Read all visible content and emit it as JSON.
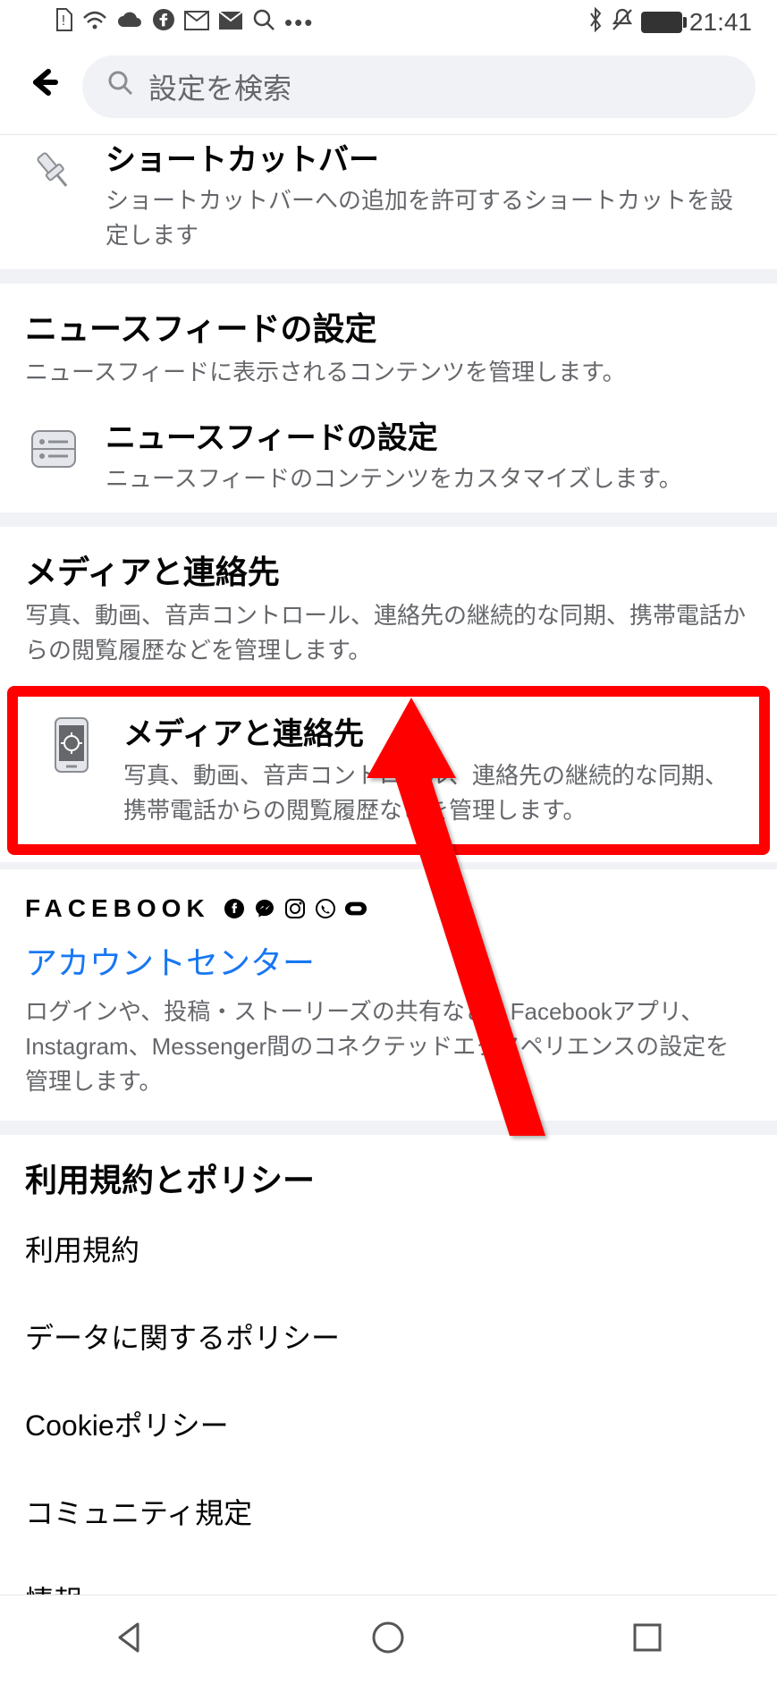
{
  "status": {
    "time": "21:41"
  },
  "search": {
    "placeholder": "設定を検索"
  },
  "shortcut": {
    "title": "ショートカットバー",
    "sub": "ショートカットバーへの追加を許可するショートカットを設定します"
  },
  "newsfeed": {
    "section_title": "ニュースフィードの設定",
    "section_sub": "ニュースフィードに表示されるコンテンツを管理します。",
    "item_title": "ニュースフィードの設定",
    "item_sub": "ニュースフィードのコンテンツをカスタマイズします。"
  },
  "media": {
    "section_title": "メディアと連絡先",
    "section_sub": "写真、動画、音声コントロール、連絡先の継続的な同期、携帯電話からの閲覧履歴などを管理します。",
    "item_title": "メディアと連絡先",
    "item_sub": "写真、動画、音声コントロール、連絡先の継続的な同期、携帯電話からの閲覧履歴などを管理します。"
  },
  "fb": {
    "logo": "FACEBOOK",
    "ac_title": "アカウントセンター",
    "ac_sub": "ログインや、投稿・ストーリーズの共有など、Facebookアプリ、Instagram、Messenger間のコネクテッドエクスペリエンスの設定を管理します。"
  },
  "policy": {
    "section_title": "利用規約とポリシー",
    "items": [
      "利用規約",
      "データに関するポリシー",
      "Cookieポリシー",
      "コミュニティ規定",
      "情報"
    ]
  }
}
